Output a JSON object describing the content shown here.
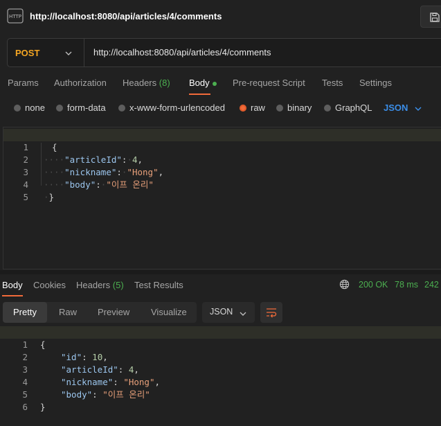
{
  "title_bar": {
    "app_badge": "HTTP",
    "title": "http://localhost:8080/api/articles/4/comments"
  },
  "url_bar": {
    "method": "POST",
    "url": "http://localhost:8080/api/articles/4/comments"
  },
  "request_tabs": [
    {
      "label": "Params"
    },
    {
      "label": "Authorization"
    },
    {
      "label": "Headers",
      "count": "(8)"
    },
    {
      "label": "Body"
    },
    {
      "label": "Pre-request Script"
    },
    {
      "label": "Tests"
    },
    {
      "label": "Settings"
    }
  ],
  "body_types": [
    "none",
    "form-data",
    "x-www-form-urlencoded",
    "raw",
    "binary",
    "GraphQL"
  ],
  "body_format": "JSON",
  "request_body": {
    "line_numbers": [
      "1",
      "2",
      "3",
      "4",
      "5"
    ],
    "open_brace": "{",
    "close_brace": "}",
    "fields": [
      {
        "key": "\"articleId\"",
        "value": "4",
        "sep": ":",
        "trail": ","
      },
      {
        "key": "\"nickname\"",
        "value": "\"Hong\"",
        "sep": ":",
        "trail": ","
      },
      {
        "key": "\"body\"",
        "value": "\"이프 온리\"",
        "sep": ":",
        "trail": ""
      }
    ],
    "whitespace_marker": "····",
    "space_marker": "·"
  },
  "response_tabs": [
    {
      "label": "Body"
    },
    {
      "label": "Cookies"
    },
    {
      "label": "Headers",
      "count": "(5)"
    },
    {
      "label": "Test Results"
    }
  ],
  "response_status": {
    "status": "200 OK",
    "time": "78 ms",
    "size": "242"
  },
  "view_tabs": [
    "Pretty",
    "Raw",
    "Preview",
    "Visualize"
  ],
  "response_format": "JSON",
  "response_body": {
    "line_numbers": [
      "1",
      "2",
      "3",
      "4",
      "5",
      "6"
    ],
    "open_brace": "{",
    "close_brace": "}",
    "fields": [
      {
        "key": "\"id\"",
        "value": "10",
        "trail": ","
      },
      {
        "key": "\"articleId\"",
        "value": "4",
        "trail": ","
      },
      {
        "key": "\"nickname\"",
        "value": "\"Hong\"",
        "trail": ","
      },
      {
        "key": "\"body\"",
        "value": "\"이프 온리\"",
        "trail": ""
      }
    ]
  },
  "colors": {
    "accent_orange": "#f26b3a",
    "method_post": "#f5a623",
    "success_green": "#4caf50",
    "link_blue": "#3b8ee8"
  },
  "icons": [
    "http-icon",
    "save-icon",
    "chevron-down-icon",
    "globe-icon",
    "wrap-lines-icon"
  ]
}
